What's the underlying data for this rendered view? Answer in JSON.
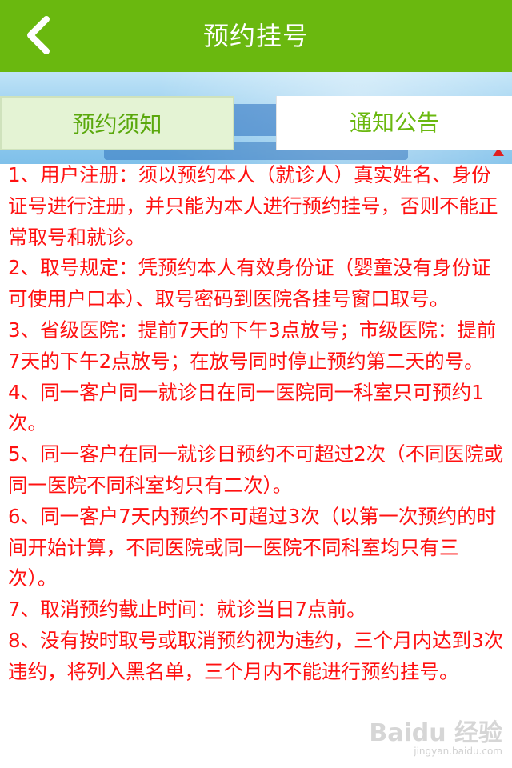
{
  "header": {
    "title": "预约挂号",
    "back_icon": "chevron-left-icon",
    "background": "#6ab80f"
  },
  "tabs": [
    {
      "label": "预约须知",
      "active": true
    },
    {
      "label": "通知公告",
      "active": false
    }
  ],
  "rules": [
    "1、用户注册：须以预约本人（就诊人）真实姓名、身份证号进行注册，并只能为本人进行预约挂号，否则不能正常取号和就诊。",
    "2、取号规定：凭预约本人有效身份证（婴童没有身份证可使用户口本）、取号密码到医院各挂号窗口取号。",
    "3、省级医院：提前7天的下午3点放号；市级医院：提前7天的下午2点放号；在放号同时停止预约第二天的号。",
    "4、同一客户同一就诊日在同一医院同一科室只可预约1次。",
    "5、同一客户在同一就诊日预约不可超过2次（不同医院或同一医院不同科室均只有二次）。",
    "6、同一客户7天内预约不可超过3次（以第一次预约的时间开始计算，不同医院或同一医院不同科室均只有三次）。",
    "7、取消预约截止时间：就诊当日7点前。",
    "8、没有按时取号或取消预约视为违约，三个月内达到3次违约，将列入黑名单，三个月内不能进行预约挂号。"
  ],
  "watermark": {
    "brand": "Baidu 经验",
    "url": "jingyan.baidu.com"
  },
  "colors": {
    "accent": "#6ab80f",
    "rule_text": "#ff1111"
  }
}
